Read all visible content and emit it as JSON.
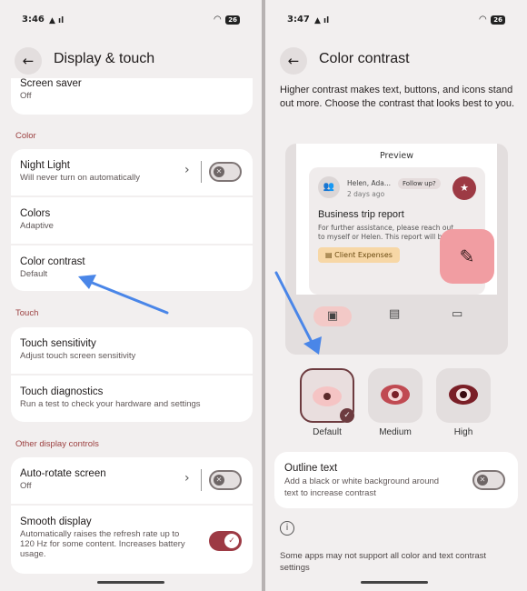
{
  "left": {
    "status": {
      "time": "3:46",
      "battery": "26"
    },
    "title": "Display & touch",
    "screen_saver": {
      "title": "Screen saver",
      "sub": "Off"
    },
    "sections": {
      "color": "Color",
      "touch": "Touch",
      "other": "Other display controls"
    },
    "night_light": {
      "title": "Night Light",
      "sub": "Will never turn on automatically"
    },
    "colors": {
      "title": "Colors",
      "sub": "Adaptive"
    },
    "color_contrast": {
      "title": "Color contrast",
      "sub": "Default"
    },
    "touch_sensitivity": {
      "title": "Touch sensitivity",
      "sub": "Adjust touch screen sensitivity"
    },
    "touch_diagnostics": {
      "title": "Touch diagnostics",
      "sub": "Run a test to check your hardware and settings"
    },
    "auto_rotate": {
      "title": "Auto-rotate screen",
      "sub": "Off"
    },
    "smooth_display": {
      "title": "Smooth display",
      "sub": "Automatically raises the refresh rate up to 120 Hz for some content. Increases battery usage."
    }
  },
  "right": {
    "status": {
      "time": "3:47",
      "battery": "26"
    },
    "title": "Color contrast",
    "description": "Higher contrast makes text, buttons, and icons stand out more. Choose the contrast that looks best to you.",
    "preview": {
      "label": "Preview",
      "sender": "Helen, Ada...",
      "chip": "Follow up?",
      "time": "2 days ago",
      "subject": "Business trip report",
      "body": "For further assistance, please reach out to myself or Helen. This report will be...",
      "tag": "Client Expenses"
    },
    "options": [
      {
        "label": "Default"
      },
      {
        "label": "Medium"
      },
      {
        "label": "High"
      }
    ],
    "outline": {
      "title": "Outline text",
      "sub": "Add a black or white background around text to increase contrast"
    },
    "footer": "Some apps may not support all color and text contrast settings"
  },
  "colors": {
    "accent": "#9d3a44",
    "arrow": "#4a86e8"
  }
}
